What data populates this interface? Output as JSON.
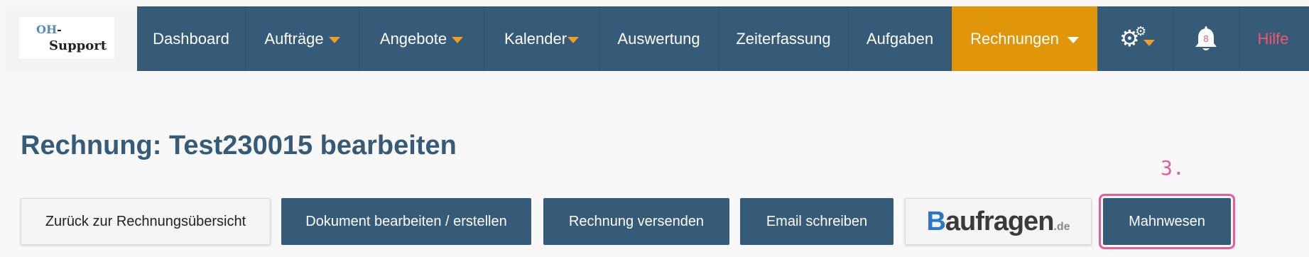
{
  "logo": {
    "line1_a": "OH",
    "line1_b": "-",
    "line2": "Support"
  },
  "nav": {
    "dashboard": "Dashboard",
    "auftraege": "Aufträge",
    "angebote": "Angebote",
    "kalender": "Kalender",
    "auswertung": "Auswertung",
    "zeiterfassung": "Zeiterfassung",
    "aufgaben": "Aufgaben",
    "rechnungen": "Rechnungen",
    "notification_count": "8",
    "hilfe": "Hilfe"
  },
  "icons": {
    "settings": "gears-icon",
    "notifications": "bell-icon",
    "dropdown": "chevron-down-icon"
  },
  "colors": {
    "nav_background": "#355b78",
    "active_tab": "#e1960a",
    "caret": "#f0a020",
    "hilfe": "#f0566a",
    "highlight": "#ec5a98"
  },
  "page": {
    "title": "Rechnung: Test230015 bearbeiten"
  },
  "annotation": {
    "step": "3."
  },
  "actions": {
    "back": "Zurück zur Rechnungsübersicht",
    "edit_document": "Dokument bearbeiten / erstellen",
    "send_invoice": "Rechnung versenden",
    "write_email": "Email schreiben",
    "baufragen_b": "B",
    "baufragen_rest": "aufragen",
    "baufragen_tld": ".de",
    "dunning": "Mahnwesen"
  }
}
